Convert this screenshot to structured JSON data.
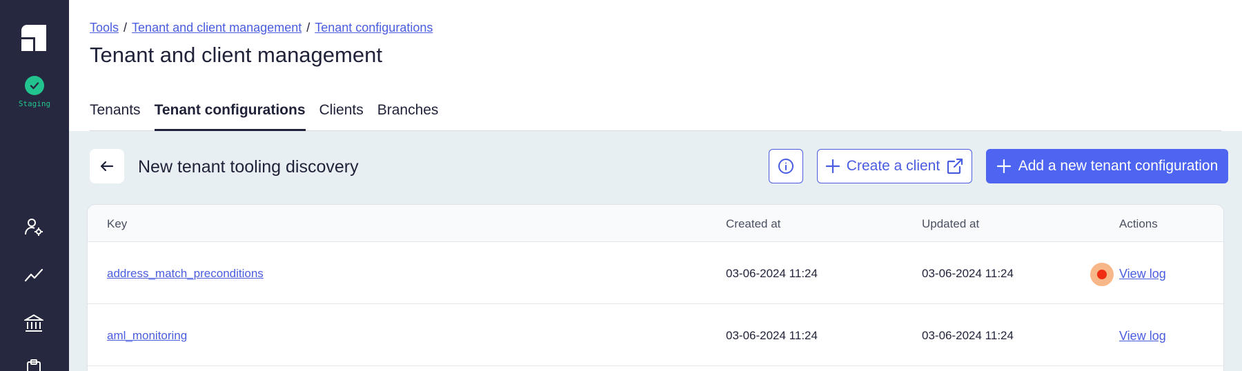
{
  "sidebar": {
    "environment": "Staging",
    "icons": [
      "logo-icon",
      "user-settings-icon",
      "trend-chart-icon",
      "bank-icon",
      "clipboard-icon"
    ]
  },
  "breadcrumb": {
    "items": [
      "Tools",
      "Tenant and client management",
      "Tenant configurations"
    ],
    "separator": "/"
  },
  "page_title": "Tenant and client management",
  "tabs": [
    {
      "label": "Tenants",
      "active": false
    },
    {
      "label": "Tenant configurations",
      "active": true
    },
    {
      "label": "Clients",
      "active": false
    },
    {
      "label": "Branches",
      "active": false
    }
  ],
  "toolbar": {
    "title": "New tenant tooling discovery",
    "create_client_label": "Create a client",
    "add_config_label": "Add a new tenant configuration"
  },
  "table": {
    "columns": [
      "Key",
      "Created at",
      "Updated at",
      "Actions"
    ],
    "rows": [
      {
        "key": "address_match_preconditions",
        "created_at": "03-06-2024 11:24",
        "updated_at": "03-06-2024 11:24",
        "action": "View log"
      },
      {
        "key": "aml_monitoring",
        "created_at": "03-06-2024 11:24",
        "updated_at": "03-06-2024 11:24",
        "action": "View log"
      }
    ]
  },
  "colors": {
    "sidebar_bg": "#26283f",
    "accent": "#4e65f2",
    "link": "#4a5ce0",
    "env_green": "#22c38e",
    "content_bg": "#e7eff3",
    "recording_dot": "#f02d12"
  }
}
